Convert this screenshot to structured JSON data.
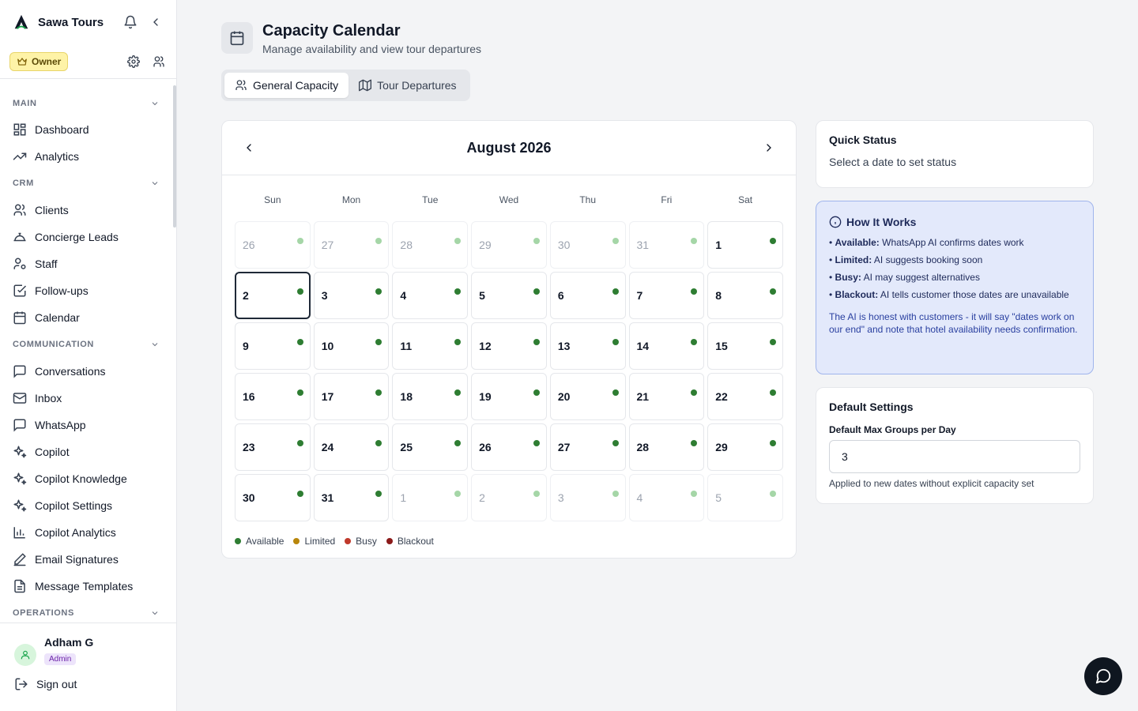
{
  "app": {
    "brand": "Sawa Tours",
    "role_badge": "Owner"
  },
  "sidebar": {
    "sections": [
      {
        "title": "MAIN",
        "items": [
          "Dashboard",
          "Analytics"
        ]
      },
      {
        "title": "CRM",
        "items": [
          "Clients",
          "Concierge Leads",
          "Staff",
          "Follow-ups",
          "Calendar"
        ]
      },
      {
        "title": "COMMUNICATION",
        "items": [
          "Conversations",
          "Inbox",
          "WhatsApp",
          "Copilot",
          "Copilot Knowledge",
          "Copilot Settings",
          "Copilot Analytics",
          "Email Signatures",
          "Message Templates"
        ]
      },
      {
        "title": "OPERATIONS",
        "items": []
      }
    ],
    "user": {
      "name": "Adham G",
      "badge": "Admin"
    },
    "sign_out": "Sign out"
  },
  "page": {
    "title": "Capacity Calendar",
    "subtitle": "Manage availability and view tour departures",
    "tabs": [
      {
        "label": "General Capacity",
        "active": true
      },
      {
        "label": "Tour Departures",
        "active": false
      }
    ]
  },
  "calendar": {
    "month_label": "August 2026",
    "weekdays": [
      "Sun",
      "Mon",
      "Tue",
      "Wed",
      "Thu",
      "Fri",
      "Sat"
    ],
    "days": [
      {
        "n": "26",
        "other": true
      },
      {
        "n": "27",
        "other": true
      },
      {
        "n": "28",
        "other": true
      },
      {
        "n": "29",
        "other": true
      },
      {
        "n": "30",
        "other": true
      },
      {
        "n": "31",
        "other": true
      },
      {
        "n": "1"
      },
      {
        "n": "2",
        "selected": true
      },
      {
        "n": "3"
      },
      {
        "n": "4"
      },
      {
        "n": "5"
      },
      {
        "n": "6"
      },
      {
        "n": "7"
      },
      {
        "n": "8"
      },
      {
        "n": "9"
      },
      {
        "n": "10"
      },
      {
        "n": "11"
      },
      {
        "n": "12"
      },
      {
        "n": "13"
      },
      {
        "n": "14"
      },
      {
        "n": "15"
      },
      {
        "n": "16"
      },
      {
        "n": "17"
      },
      {
        "n": "18"
      },
      {
        "n": "19"
      },
      {
        "n": "20"
      },
      {
        "n": "21"
      },
      {
        "n": "22"
      },
      {
        "n": "23"
      },
      {
        "n": "24"
      },
      {
        "n": "25"
      },
      {
        "n": "26"
      },
      {
        "n": "27"
      },
      {
        "n": "28"
      },
      {
        "n": "29"
      },
      {
        "n": "30"
      },
      {
        "n": "31"
      },
      {
        "n": "1",
        "other": true
      },
      {
        "n": "2",
        "other": true
      },
      {
        "n": "3",
        "other": true
      },
      {
        "n": "4",
        "other": true
      },
      {
        "n": "5",
        "other": true
      }
    ],
    "legend": [
      {
        "label": "Available",
        "color": "#2e7d32"
      },
      {
        "label": "Limited",
        "color": "#b8860b"
      },
      {
        "label": "Busy",
        "color": "#c0392b"
      },
      {
        "label": "Blackout",
        "color": "#8b1a1a"
      }
    ]
  },
  "quick_status": {
    "title": "Quick Status",
    "text": "Select a date to set status"
  },
  "how_it_works": {
    "title": "How It Works",
    "items": [
      {
        "label": "Available:",
        "text": "WhatsApp AI confirms dates work"
      },
      {
        "label": "Limited:",
        "text": "AI suggests booking soon"
      },
      {
        "label": "Busy:",
        "text": "AI may suggest alternatives"
      },
      {
        "label": "Blackout:",
        "text": "AI tells customer those dates are unavailable"
      }
    ],
    "note": "The AI is honest with customers - it will say \"dates work on our end\" and note that hotel availability needs confirmation."
  },
  "default_settings": {
    "title": "Default Settings",
    "field_label": "Default Max Groups per Day",
    "field_value": "3",
    "help": "Applied to new dates without explicit capacity set"
  }
}
